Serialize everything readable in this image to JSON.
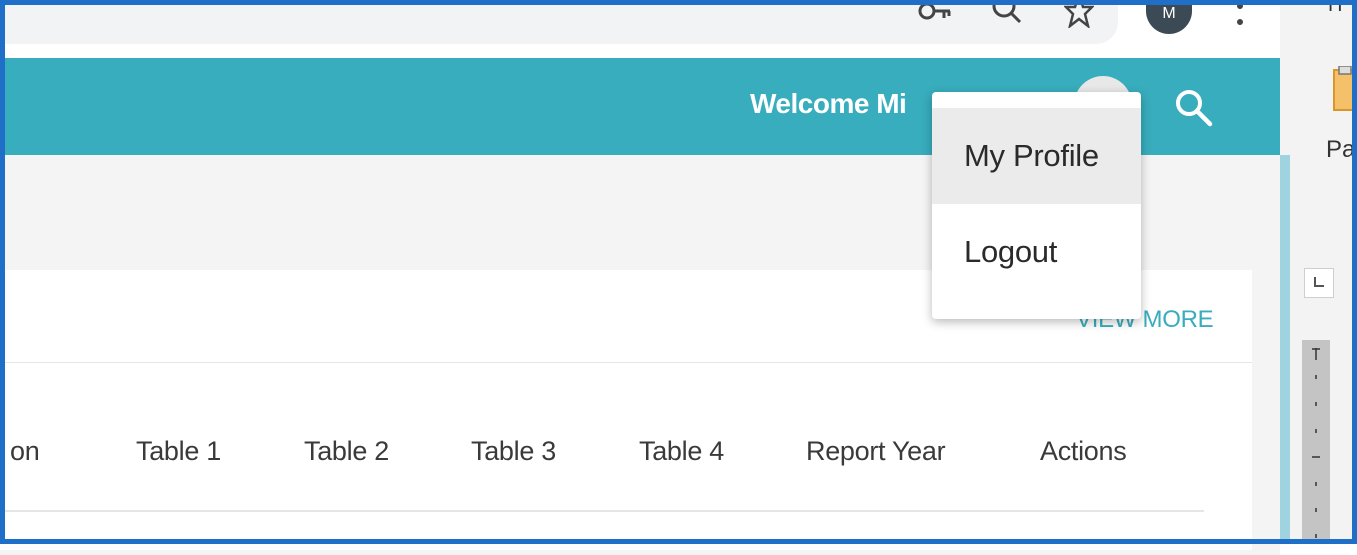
{
  "browser": {
    "icons": [
      "key-icon",
      "zoom-icon",
      "star-icon",
      "profile-avatar",
      "more-menu-icon"
    ],
    "profile_initial": "M"
  },
  "header": {
    "welcome_text": "Welcome Mi",
    "background": "#38adbd",
    "search_icon": "search-icon"
  },
  "user_menu": {
    "items": [
      {
        "label": "My Profile",
        "state": "hovered"
      },
      {
        "label": "Logout"
      }
    ]
  },
  "card": {
    "view_more": "VIEW MORE",
    "columns": [
      "on",
      "Table 1",
      "Table 2",
      "Table 3",
      "Table 4",
      "Report Year",
      "Actions"
    ]
  },
  "side_panel": {
    "top_char": "H",
    "paste_label": "Pa",
    "accent": "#9fd3df"
  },
  "colors": {
    "frame": "#1f6fc9",
    "teal": "#38adbd"
  }
}
